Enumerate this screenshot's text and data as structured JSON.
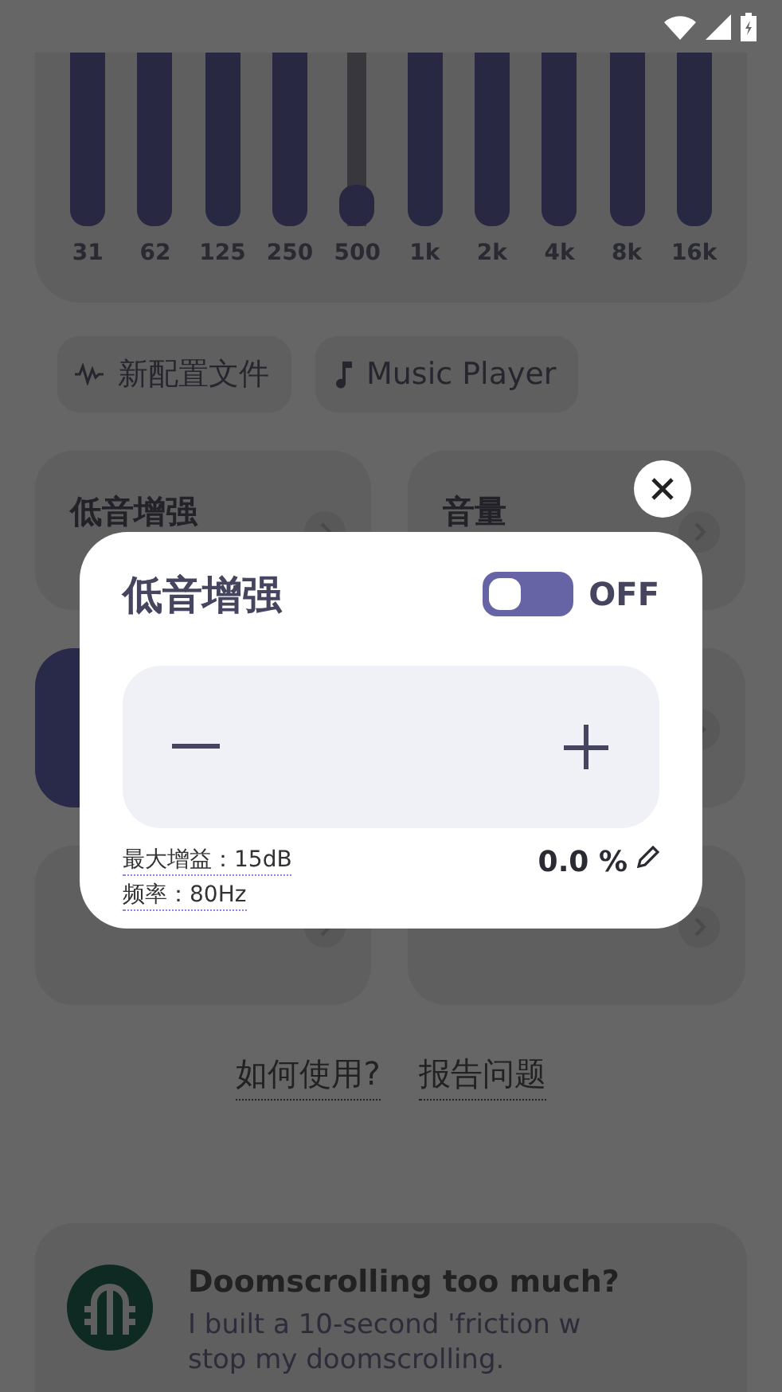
{
  "equalizer": {
    "bands": [
      {
        "label": "31",
        "level": 1
      },
      {
        "label": "62",
        "level": 1
      },
      {
        "label": "125",
        "level": 1
      },
      {
        "label": "250",
        "level": 1
      },
      {
        "label": "500",
        "level": 0.24
      },
      {
        "label": "1k",
        "level": 1
      },
      {
        "label": "2k",
        "level": 1
      },
      {
        "label": "4k",
        "level": 1
      },
      {
        "label": "8k",
        "level": 1
      },
      {
        "label": "16k",
        "level": 1
      }
    ]
  },
  "chips": [
    {
      "label": "新配置文件",
      "kind": "wave"
    },
    {
      "label": "Music Player",
      "kind": "music"
    }
  ],
  "cards": [
    {
      "title": "低音增强",
      "on": false
    },
    {
      "title": "音量",
      "on": false
    },
    {
      "on": true
    },
    {
      "on": false
    },
    {
      "on": false
    },
    {
      "on": false
    }
  ],
  "links": [
    "如何使用?",
    "报告问题"
  ],
  "promo": {
    "title": "Doomscrolling too much?",
    "lines": [
      "I built a 10-second 'friction w",
      "stop my doomscrolling."
    ]
  },
  "dialog": {
    "title": "低音增强",
    "toggle": {
      "on": false,
      "label": "OFF"
    },
    "max_gain": "最大增益：15dB",
    "frequency": "频率：80Hz",
    "value": "0.0 %"
  }
}
